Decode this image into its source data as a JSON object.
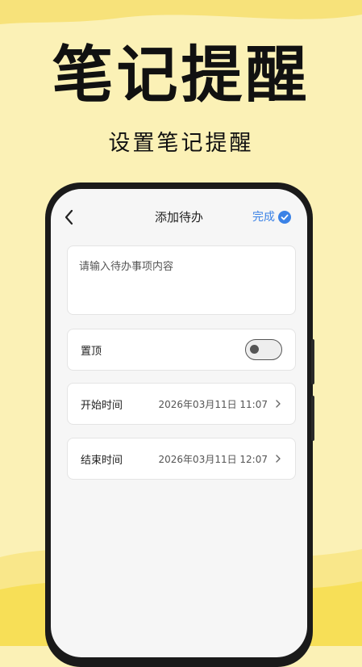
{
  "promo": {
    "title": "笔记提醒",
    "subtitle": "设置笔记提醒"
  },
  "nav": {
    "title": "添加待办",
    "done_label": "完成",
    "back_icon": "chevron-left-icon",
    "done_icon": "check-circle-icon"
  },
  "form": {
    "content_placeholder": "请输入待办事项内容",
    "content_value": "",
    "pin_label": "置顶",
    "pin_on": false,
    "start_label": "开始时间",
    "start_value": "2026年03月11日 11:07",
    "end_label": "结束时间",
    "end_value": "2026年03月11日 12:07"
  },
  "colors": {
    "background": "#fbf1b6",
    "accent": "#3b82e6",
    "wave_yellow": "#f7df57"
  }
}
